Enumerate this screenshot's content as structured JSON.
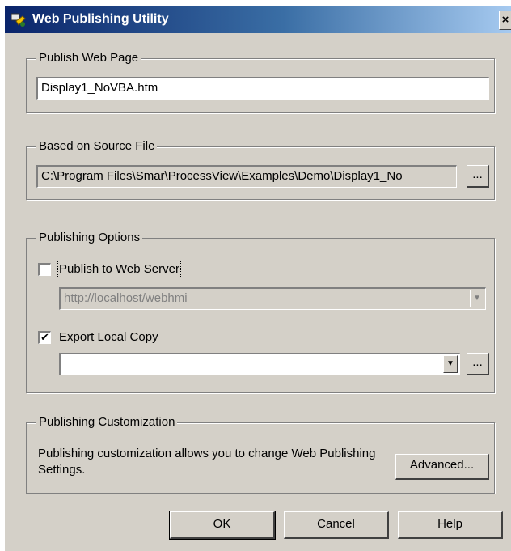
{
  "window": {
    "title": "Web Publishing Utility",
    "close_label": "×"
  },
  "publish_page": {
    "group_label": "Publish Web Page",
    "value": "Display1_NoVBA.htm"
  },
  "source_file": {
    "group_label": "Based on Source File",
    "value": "C:\\Program Files\\Smar\\ProcessView\\Examples\\Demo\\Display1_No",
    "browse_label": "..."
  },
  "options": {
    "group_label": "Publishing Options",
    "web_server": {
      "label": "Publish to Web Server",
      "checked": false,
      "url": "http://localhost/webhmi"
    },
    "local_copy": {
      "label": "Export Local Copy",
      "checked": true,
      "check_mark": "✔",
      "path": "",
      "browse_label": "..."
    }
  },
  "customization": {
    "group_label": "Publishing Customization",
    "description": "Publishing customization allows you  to change Web Publishing Settings.",
    "advanced_label": "Advanced..."
  },
  "buttons": {
    "ok": "OK",
    "cancel": "Cancel",
    "help": "Help"
  }
}
